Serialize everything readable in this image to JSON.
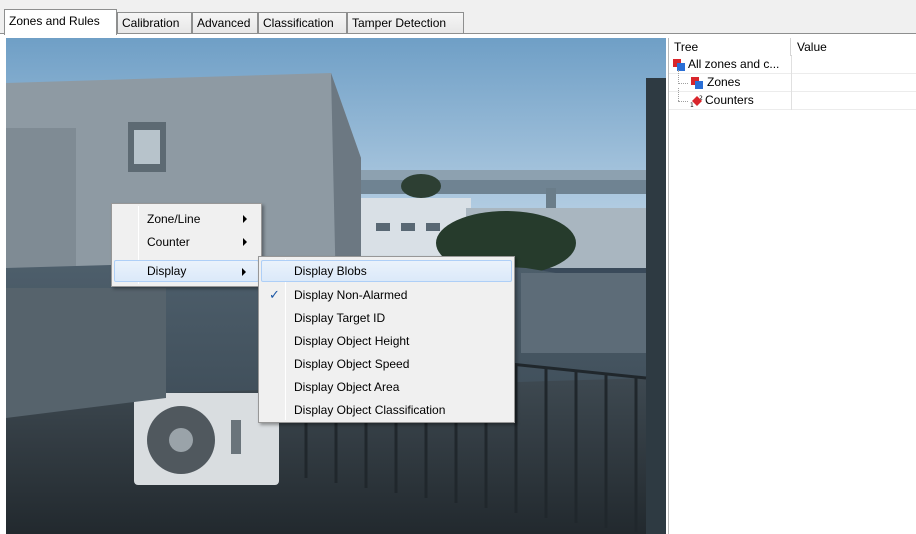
{
  "tabs": [
    {
      "label": "Zones and Rules",
      "active": true
    },
    {
      "label": "Calibration",
      "active": false
    },
    {
      "label": "Advanced",
      "active": false
    },
    {
      "label": "Classification",
      "active": false
    },
    {
      "label": "Tamper Detection",
      "active": false
    }
  ],
  "tree": {
    "columns": {
      "tree": "Tree",
      "value": "Value"
    },
    "rows": [
      {
        "label": "All zones and c...",
        "icon": "all-zones-icon",
        "value": ""
      },
      {
        "label": "Zones",
        "icon": "zones-icon",
        "value": ""
      },
      {
        "label": "Counters",
        "icon": "counters-icon",
        "value": ""
      }
    ]
  },
  "context_menu": {
    "items": [
      {
        "label": "Zone/Line",
        "has_submenu": true
      },
      {
        "label": "Counter",
        "has_submenu": true
      },
      {
        "label": "Display",
        "has_submenu": true,
        "highlighted": true
      }
    ]
  },
  "display_submenu": {
    "items": [
      {
        "label": "Display Blobs",
        "checked": false,
        "highlighted": true
      },
      {
        "label": "Display Non-Alarmed",
        "checked": true,
        "highlighted": false
      },
      {
        "label": "Display Target ID",
        "checked": false,
        "highlighted": false
      },
      {
        "label": "Display Object Height",
        "checked": false,
        "highlighted": false
      },
      {
        "label": "Display Object Speed",
        "checked": false,
        "highlighted": false
      },
      {
        "label": "Display Object Area",
        "checked": false,
        "highlighted": false
      },
      {
        "label": "Display Object Classification",
        "checked": false,
        "highlighted": false
      }
    ]
  },
  "colors": {
    "menu_highlight": "#dbe9f9",
    "check": "#1c57a5"
  }
}
